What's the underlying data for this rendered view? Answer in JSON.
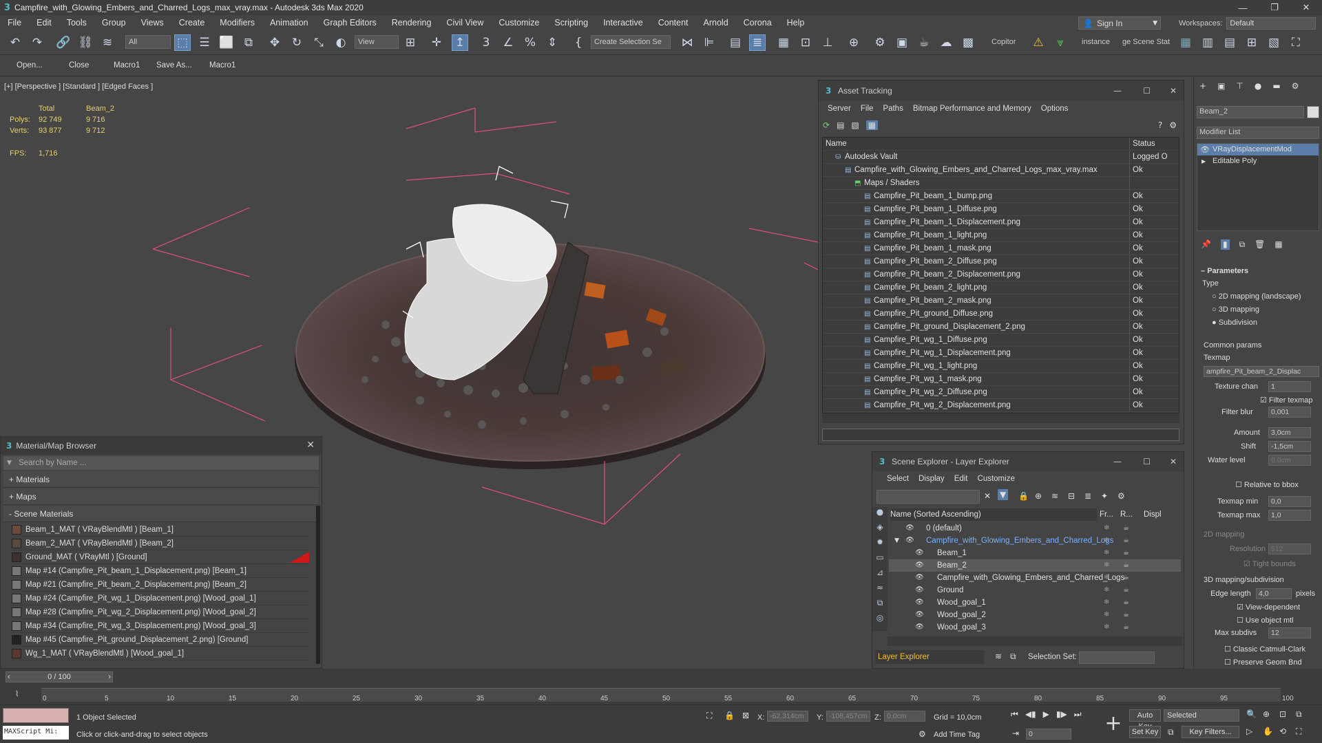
{
  "window": {
    "title": "Campfire_with_Glowing_Embers_and_Charred_Logs_max_vray.max - Autodesk 3ds Max 2020"
  },
  "menu": [
    "File",
    "Edit",
    "Tools",
    "Group",
    "Views",
    "Create",
    "Modifiers",
    "Animation",
    "Graph Editors",
    "Rendering",
    "Civil View",
    "Customize",
    "Scripting",
    "Interactive",
    "Content",
    "Arnold",
    "Corona",
    "Help"
  ],
  "account": {
    "signin": "Sign In",
    "workspaces_label": "Workspaces:",
    "workspace": "Default"
  },
  "toolbar": {
    "filter": "All",
    "view": "View",
    "selection_set": "Create Selection Se",
    "copitor": "Copitor",
    "instance": "instance",
    "scene_stat": "ge Scene Stat"
  },
  "toolbar2": [
    "Open...",
    "Close",
    "Macro1",
    "Save As...",
    "Macro1"
  ],
  "viewport": {
    "label": "[+] [Perspective ] [Standard ] [Edged Faces ]",
    "stats": {
      "col_total": "Total",
      "col_obj": "Beam_2",
      "polys_label": "Polys:",
      "polys_total": "92 749",
      "polys_obj": "9 716",
      "verts_label": "Verts:",
      "verts_total": "93 877",
      "verts_obj": "9 712",
      "fps_label": "FPS:",
      "fps": "1,716"
    }
  },
  "material_browser": {
    "title": "Material/Map Browser",
    "search_placeholder": "Search by Name ...",
    "sections": [
      "+ Materials",
      "+ Maps",
      "- Scene Materials"
    ],
    "items": [
      {
        "label": "Beam_1_MAT  ( VRayBlendMtl ) [Beam_1]",
        "color": "#6a4a3a"
      },
      {
        "label": "Beam_2_MAT  ( VRayBlendMtl ) [Beam_2]",
        "color": "#5a4a40"
      },
      {
        "label": "Ground_MAT  ( VRayMtl ) [Ground]",
        "color": "#3a3030"
      },
      {
        "label": "Map #14 (Campfire_Pit_beam_1_Displacement.png) [Beam_1]",
        "color": "#777777"
      },
      {
        "label": "Map #21 (Campfire_Pit_beam_2_Displacement.png) [Beam_2]",
        "color": "#777777"
      },
      {
        "label": "Map #24 (Campfire_Pit_wg_1_Displacement.png) [Wood_goal_1]",
        "color": "#777777"
      },
      {
        "label": "Map #28 (Campfire_Pit_wg_2_Displacement.png) [Wood_goal_2]",
        "color": "#777777"
      },
      {
        "label": "Map #34 (Campfire_Pit_wg_3_Displacement.png) [Wood_goal_3]",
        "color": "#777777"
      },
      {
        "label": "Map #45 (Campfire_Pit_ground_Displacement_2.png) [Ground]",
        "color": "#222222"
      },
      {
        "label": "Wg_1_MAT  ( VRayBlendMtl ) [Wood_goal_1]",
        "color": "#5a3a30"
      }
    ]
  },
  "asset_tracking": {
    "title": "Asset Tracking",
    "menu": [
      "Server",
      "File",
      "Paths",
      "Bitmap Performance and Memory",
      "Options"
    ],
    "col_name": "Name",
    "col_status": "Status",
    "rows": [
      {
        "name": "Autodesk Vault",
        "status": "Logged O",
        "indent": 0
      },
      {
        "name": "Campfire_with_Glowing_Embers_and_Charred_Logs_max_vray.max",
        "status": "Ok",
        "indent": 1
      },
      {
        "name": "Maps / Shaders",
        "status": "",
        "indent": 2
      },
      {
        "name": "Campfire_Pit_beam_1_bump.png",
        "status": "Ok",
        "indent": 3
      },
      {
        "name": "Campfire_Pit_beam_1_Diffuse.png",
        "status": "Ok",
        "indent": 3
      },
      {
        "name": "Campfire_Pit_beam_1_Displacement.png",
        "status": "Ok",
        "indent": 3
      },
      {
        "name": "Campfire_Pit_beam_1_light.png",
        "status": "Ok",
        "indent": 3
      },
      {
        "name": "Campfire_Pit_beam_1_mask.png",
        "status": "Ok",
        "indent": 3
      },
      {
        "name": "Campfire_Pit_beam_2_Diffuse.png",
        "status": "Ok",
        "indent": 3
      },
      {
        "name": "Campfire_Pit_beam_2_Displacement.png",
        "status": "Ok",
        "indent": 3
      },
      {
        "name": "Campfire_Pit_beam_2_light.png",
        "status": "Ok",
        "indent": 3
      },
      {
        "name": "Campfire_Pit_beam_2_mask.png",
        "status": "Ok",
        "indent": 3
      },
      {
        "name": "Campfire_Pit_ground_Diffuse.png",
        "status": "Ok",
        "indent": 3
      },
      {
        "name": "Campfire_Pit_ground_Displacement_2.png",
        "status": "Ok",
        "indent": 3
      },
      {
        "name": "Campfire_Pit_wg_1_Diffuse.png",
        "status": "Ok",
        "indent": 3
      },
      {
        "name": "Campfire_Pit_wg_1_Displacement.png",
        "status": "Ok",
        "indent": 3
      },
      {
        "name": "Campfire_Pit_wg_1_light.png",
        "status": "Ok",
        "indent": 3
      },
      {
        "name": "Campfire_Pit_wg_1_mask.png",
        "status": "Ok",
        "indent": 3
      },
      {
        "name": "Campfire_Pit_wg_2_Diffuse.png",
        "status": "Ok",
        "indent": 3
      },
      {
        "name": "Campfire_Pit_wg_2_Displacement.png",
        "status": "Ok",
        "indent": 3
      }
    ]
  },
  "scene_explorer": {
    "title": "Scene Explorer - Layer Explorer",
    "menu": [
      "Select",
      "Display",
      "Edit",
      "Customize"
    ],
    "col_name": "Name (Sorted Ascending)",
    "col_fr": "Fr...",
    "col_r": "R...",
    "col_disp": "Displ",
    "rows": [
      {
        "name": "0 (default)",
        "level": 0,
        "selected": false,
        "highlight": false
      },
      {
        "name": "Campfire_with_Glowing_Embers_and_Charred_Logs",
        "level": 0,
        "selected": false,
        "highlight": true
      },
      {
        "name": "Beam_1",
        "level": 1,
        "selected": false,
        "highlight": false
      },
      {
        "name": "Beam_2",
        "level": 1,
        "selected": true,
        "highlight": false
      },
      {
        "name": "Campfire_with_Glowing_Embers_and_Charred_Logs",
        "level": 1,
        "selected": false,
        "highlight": false
      },
      {
        "name": "Ground",
        "level": 1,
        "selected": false,
        "highlight": false
      },
      {
        "name": "Wood_goal_1",
        "level": 1,
        "selected": false,
        "highlight": false
      },
      {
        "name": "Wood_goal_2",
        "level": 1,
        "selected": false,
        "highlight": false
      },
      {
        "name": "Wood_goal_3",
        "level": 1,
        "selected": false,
        "highlight": false
      }
    ],
    "footer_explorer": "Layer Explorer",
    "footer_selset": "Selection Set:"
  },
  "command_panel": {
    "object_name": "Beam_2",
    "modifier_list": "Modifier List",
    "stack": [
      "VRayDisplacementMod",
      "Editable Poly"
    ],
    "params_title": "Parameters",
    "type_label": "Type",
    "type_options": [
      "2D mapping (landscape)",
      "3D mapping",
      "Subdivision"
    ],
    "common_params": "Common params",
    "texmap_label": "Texmap",
    "texmap_value": "ampfire_Pit_beam_2_Displac",
    "texture_chan_label": "Texture chan",
    "texture_chan": "1",
    "filter_texmap": "Filter texmap",
    "filter_blur_label": "Filter blur",
    "filter_blur": "0,001",
    "amount_label": "Amount",
    "amount": "3,0cm",
    "shift_label": "Shift",
    "shift": "-1,5cm",
    "water_label": "Water level",
    "water": "0,0cm",
    "relative_bbox": "Relative to bbox",
    "texmap_min_label": "Texmap min",
    "texmap_min": "0,0",
    "texmap_max_label": "Texmap max",
    "texmap_max": "1,0",
    "mapping2d": "2D mapping",
    "resolution_label": "Resolution",
    "resolution": "512",
    "tight_bounds": "Tight bounds",
    "mapping3d": "3D mapping/subdivision",
    "edge_length_label": "Edge length",
    "edge_length": "4,0",
    "pixels": "pixels",
    "view_dependent": "View-dependent",
    "use_object_mtl": "Use object mtl",
    "max_subdivs_label": "Max subdivs",
    "max_subdivs": "12",
    "classic_catmull": "Classic Catmull-Clark",
    "preserve_geom": "Preserve Geom Bnd"
  },
  "timeline": {
    "frame": "0 / 100",
    "ticks": [
      "0",
      "5",
      "10",
      "15",
      "20",
      "25",
      "30",
      "35",
      "40",
      "45",
      "50",
      "55",
      "60",
      "65",
      "70",
      "75",
      "80",
      "85",
      "90",
      "95",
      "100"
    ]
  },
  "status": {
    "maxscript": "MAXScript Mi:",
    "selected": "1 Object Selected",
    "hint": "Click or click-and-drag to select objects",
    "x_label": "X:",
    "x": "-62,314cm",
    "y_label": "Y:",
    "y": "-108,457cm",
    "z_label": "Z:",
    "z": "0,0cm",
    "grid": "Grid = 10,0cm",
    "add_time_tag": "Add Time Tag",
    "auto_key": "Auto Key",
    "selected_dd": "Selected",
    "set_key": "Set Key",
    "key_filters": "Key Filters...",
    "frame_field": "0"
  }
}
